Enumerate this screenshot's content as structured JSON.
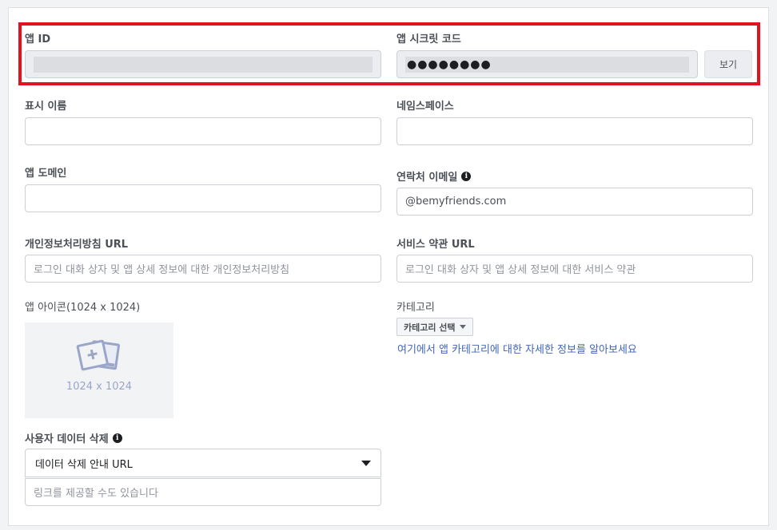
{
  "app_id": {
    "label": "앱 ID",
    "value": ""
  },
  "app_secret": {
    "label": "앱 시크릿 코드",
    "value": "●●●●●●●●",
    "view_button": "보기"
  },
  "display_name": {
    "label": "표시 이름",
    "value": ""
  },
  "namespace": {
    "label": "네임스페이스",
    "value": ""
  },
  "app_domain": {
    "label": "앱 도메인",
    "value": ""
  },
  "contact_email": {
    "label": "연락처 이메일",
    "value": "@bemyfriends.com"
  },
  "privacy_url": {
    "label": "개인정보처리방침 URL",
    "placeholder": "로그인 대화 상자 및 앱 상세 정보에 대한 개인정보처리방침"
  },
  "terms_url": {
    "label": "서비스 약관 URL",
    "placeholder": "로그인 대화 상자 및 앱 상세 정보에 대한 서비스 약관"
  },
  "app_icon": {
    "label": "앱 아이콘(1024 x 1024)",
    "caption": "1024 x 1024"
  },
  "category": {
    "label": "카테고리",
    "button": "카테고리 선택",
    "help_link": "여기에서 앱 카테고리에 대한 자세한 정보를 알아보세요"
  },
  "data_deletion": {
    "label": "사용자 데이터 삭제",
    "selected": "데이터 삭제 안내 URL",
    "placeholder": "링크를 제공할 수도 있습니다"
  },
  "colors": {
    "highlight": "#e0141e",
    "link": "#4267b2"
  }
}
